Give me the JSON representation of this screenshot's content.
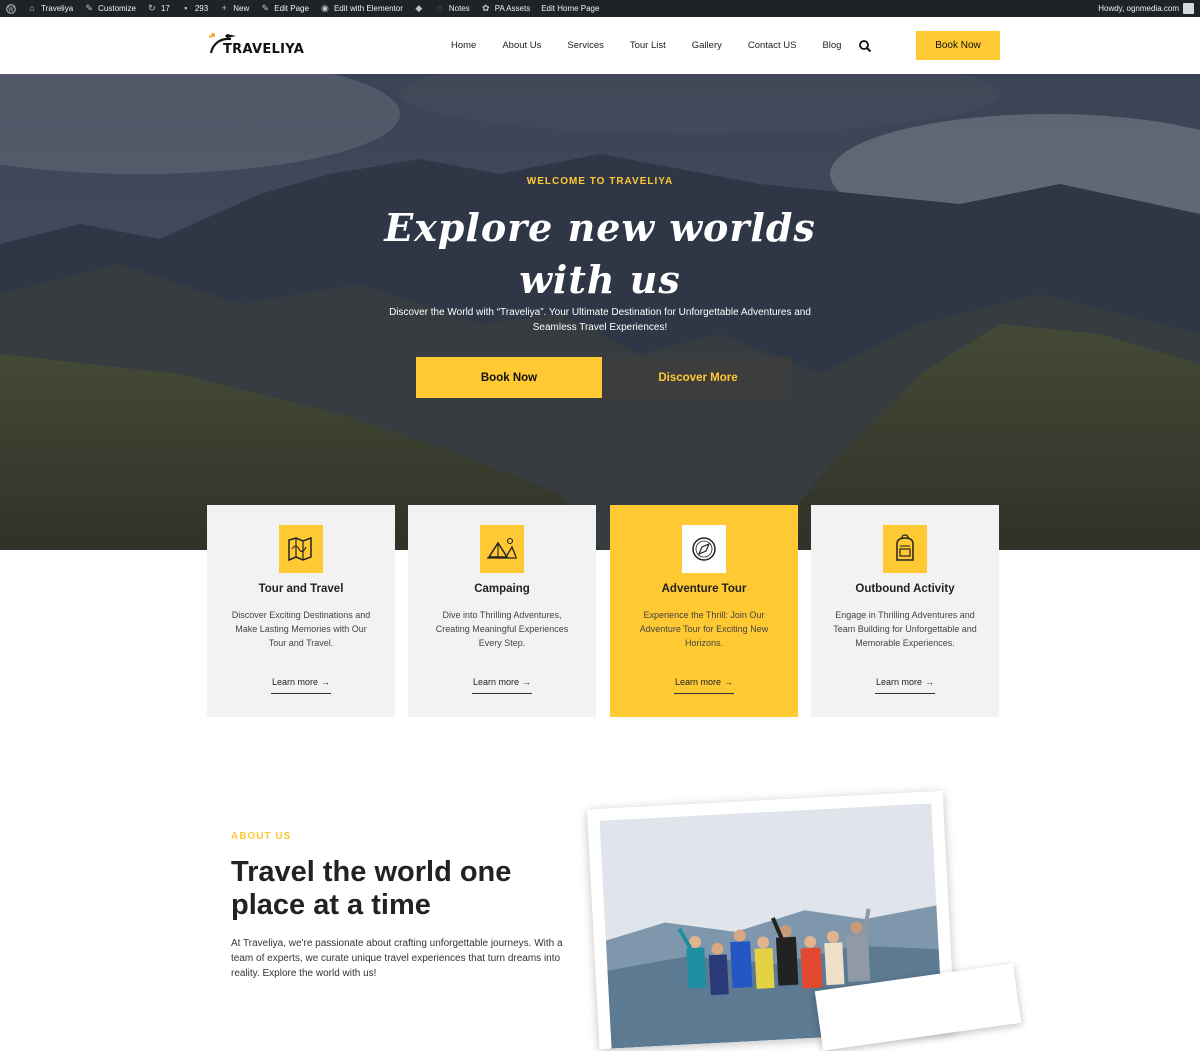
{
  "admin_bar": {
    "site_name": "Traveliya",
    "customize": "Customize",
    "updates_count": "17",
    "comments_count": "293",
    "new_label": "New",
    "edit_page": "Edit Page",
    "edit_elementor": "Edit with Elementor",
    "notes": "Notes",
    "pa_assets": "PA Assets",
    "edit_home": "Edit Home Page",
    "howdy": "Howdy, ognmedia.com"
  },
  "header": {
    "logo_text": "TRAVELIYA",
    "nav": [
      "Home",
      "About Us",
      "Services",
      "Tour List",
      "Gallery",
      "Contact US",
      "Blog"
    ],
    "book_label": "Book Now"
  },
  "hero": {
    "eyebrow": "WELCOME TO TRAVELIYA",
    "title_line1": "Explore new worlds",
    "title_line2": "with us",
    "subtitle": "Discover the World with “Traveliya”. Your Ultimate Destination for Unforgettable Adventures and Seamless Travel Experiences!",
    "book_label": "Book Now",
    "discover_label": "Discover More"
  },
  "services": [
    {
      "title": "Tour and Travel",
      "desc": "Discover Exciting Destinations and Make Lasting Memories with Our Tour and Travel.",
      "link": "Learn more",
      "icon": "map-icon"
    },
    {
      "title": "Campaing",
      "desc": "Dive into Thrilling Adventures, Creating Meaningful Experiences Every Step.",
      "link": "Learn more",
      "icon": "tent-icon"
    },
    {
      "title": "Adventure Tour",
      "desc": "Experience the Thrill: Join Our Adventure Tour for Exciting New Horizons.",
      "link": "Learn more",
      "icon": "compass-icon"
    },
    {
      "title": "Outbound Activity",
      "desc": "Engage in Thrilling Adventures and Team Building for Unforgettable and Memorable Experiences.",
      "link": "Learn more",
      "icon": "backpack-icon"
    }
  ],
  "about": {
    "eyebrow": "ABOUT US",
    "title": "Travel the world one place at a time",
    "text": "At Traveliya, we're passionate about crafting unforgettable journeys. With a team of experts, we curate unique travel experiences that turn dreams into reality. Explore the world with us!"
  },
  "colors": {
    "accent": "#ffc933",
    "dark": "#3d3d3d",
    "adminbar": "#1d2327"
  }
}
